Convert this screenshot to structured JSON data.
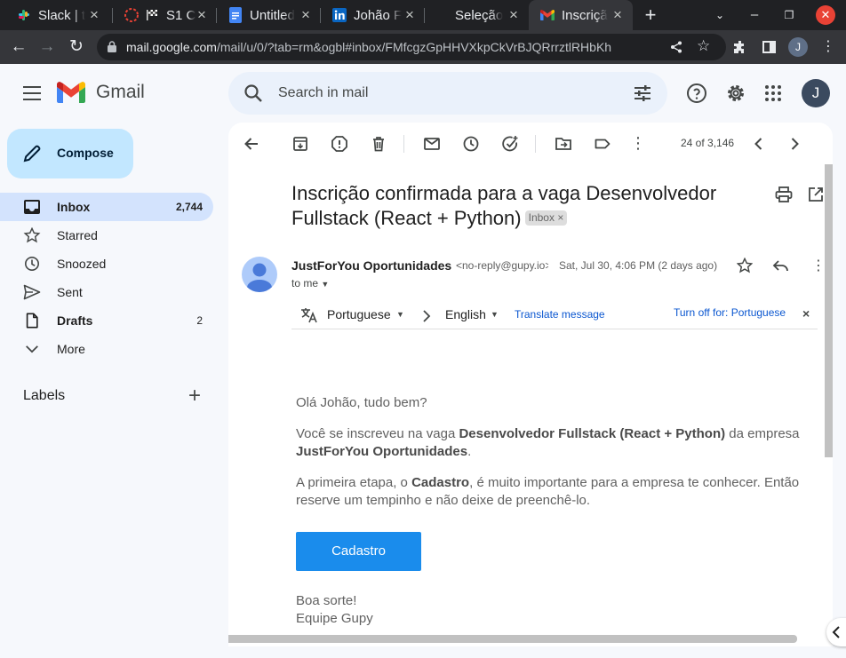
{
  "browser": {
    "tabs": [
      {
        "label": "Slack | t",
        "icon": "slack-icon"
      },
      {
        "label": "S1 C",
        "icon": "flag-icon"
      },
      {
        "label": "Untitled",
        "icon": "docs-icon"
      },
      {
        "label": "Johão F",
        "icon": "linkedin-icon"
      },
      {
        "label": "Seleção",
        "icon": "blank-icon"
      },
      {
        "label": "Inscriçã",
        "icon": "gmail-icon"
      }
    ],
    "url_host": "mail.google.com",
    "url_path": "/mail/u/0/?tab=rm&ogbl#inbox/FMfcgzGpHHVXkpCkVrBJQRrrztlRHbKh",
    "profile_initial": "J"
  },
  "gmail": {
    "brand": "Gmail",
    "search_placeholder": "Search in mail",
    "account_initial": "J"
  },
  "sidebar": {
    "compose_label": "Compose",
    "items": [
      {
        "label": "Inbox",
        "count": "2,744",
        "icon": "inbox-icon"
      },
      {
        "label": "Starred",
        "count": "",
        "icon": "star-icon"
      },
      {
        "label": "Snoozed",
        "count": "",
        "icon": "clock-icon"
      },
      {
        "label": "Sent",
        "count": "",
        "icon": "send-icon"
      },
      {
        "label": "Drafts",
        "count": "2",
        "icon": "draft-icon"
      },
      {
        "label": "More",
        "count": "",
        "icon": "chevron-down-icon"
      }
    ],
    "labels_title": "Labels"
  },
  "toolbar": {
    "pager": "24 of 3,146"
  },
  "email": {
    "subject": "Inscrição confirmada para a vaga Desenvolvedor Fullstack (React + Python)",
    "label_chip": "Inbox",
    "label_chip_close": "×",
    "sender_name": "JustForYou Oportunidades",
    "sender_email": "<no-reply@gupy.io>",
    "date": "Sat, Jul 30, 4:06 PM (2 days ago)",
    "to": "to me",
    "translate": {
      "from_lang": "Portuguese",
      "to_lang": "English",
      "translate_link": "Translate message",
      "turn_off": "Turn off for: Portuguese"
    },
    "greeting": "Olá Johão, tudo bem?",
    "p1_a": "Você se inscreveu na vaga ",
    "p1_b": "Desenvolvedor Fullstack (React + Python)",
    "p1_c": " da empresa ",
    "p1_d": "JustForYou Oportunidades",
    "p1_e": ".",
    "p2_a": "A primeira etapa, o ",
    "p2_b": "Cadastro",
    "p2_c": ", é muito importante para a empresa te conhecer. Então reserve um tempinho e não deixe de preenchê-lo.",
    "cta_label": "Cadastro",
    "signoff_1": "Boa sorte!",
    "signoff_2": "Equipe Gupy"
  }
}
